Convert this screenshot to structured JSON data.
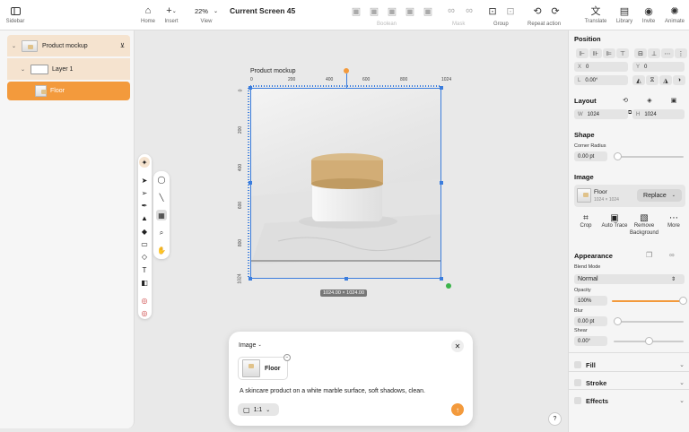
{
  "topbar": {
    "sidebar_label": "Sidebar",
    "home_label": "Home",
    "insert_label": "Insert",
    "zoom_value": "22%",
    "view_label": "View",
    "screen_title": "Current Screen 45",
    "boolean_label": "Boolean",
    "mask_label": "Mask",
    "group_label": "Group",
    "repeat_label": "Repeat action",
    "translate_label": "Translate",
    "library_label": "Library",
    "invite_label": "Invite",
    "animate_label": "Animate"
  },
  "sidebar": {
    "layers": [
      {
        "label": "Product mockup"
      },
      {
        "label": "Layer 1"
      },
      {
        "label": "Floor"
      }
    ]
  },
  "canvas": {
    "artboard_label": "Product mockup",
    "ruler_h": [
      "0",
      "200",
      "400",
      "600",
      "800",
      "1024"
    ],
    "ruler_v": [
      "0",
      "200",
      "400",
      "600",
      "800",
      "1024"
    ],
    "size_badge": "1024.00 × 1024.00"
  },
  "dialog": {
    "mode_label": "Image",
    "chip_label": "Floor",
    "prompt": "A skincare product on a white marble surface, soft shadows, clean.",
    "ratio_label": "1:1"
  },
  "help_label": "?",
  "panel": {
    "position_title": "Position",
    "x_label": "X",
    "x_value": "0",
    "y_label": "Y",
    "y_value": "0",
    "rot_label": "L",
    "rot_value": "0.00°",
    "layout_title": "Layout",
    "w_label": "W",
    "w_value": "1024",
    "h_label": "H",
    "h_value": "1024",
    "shape_title": "Shape",
    "corner_label": "Corner Radius",
    "corner_value": "0.00 pt",
    "image_title": "Image",
    "image_name": "Floor",
    "image_size": "1024 × 1024",
    "replace_label": "Replace",
    "actions": [
      {
        "label": "Crop"
      },
      {
        "label": "Auto Trace"
      },
      {
        "label": "Remove Background"
      },
      {
        "label": "More"
      }
    ],
    "appearance_title": "Appearance",
    "blend_label": "Blend Mode",
    "blend_value": "Normal",
    "opacity_label": "Opacity",
    "opacity_value": "100%",
    "opacity_fraction": 1.0,
    "blur_label": "Blur",
    "blur_value": "0.00 pt",
    "shear_label": "Shear",
    "shear_value": "0.00°",
    "fill_label": "Fill",
    "stroke_label": "Stroke",
    "effects_label": "Effects"
  },
  "colors": {
    "accent": "#f39a3c",
    "selection": "#3b7ddd",
    "layer_highlight": "#f5e3cf"
  }
}
